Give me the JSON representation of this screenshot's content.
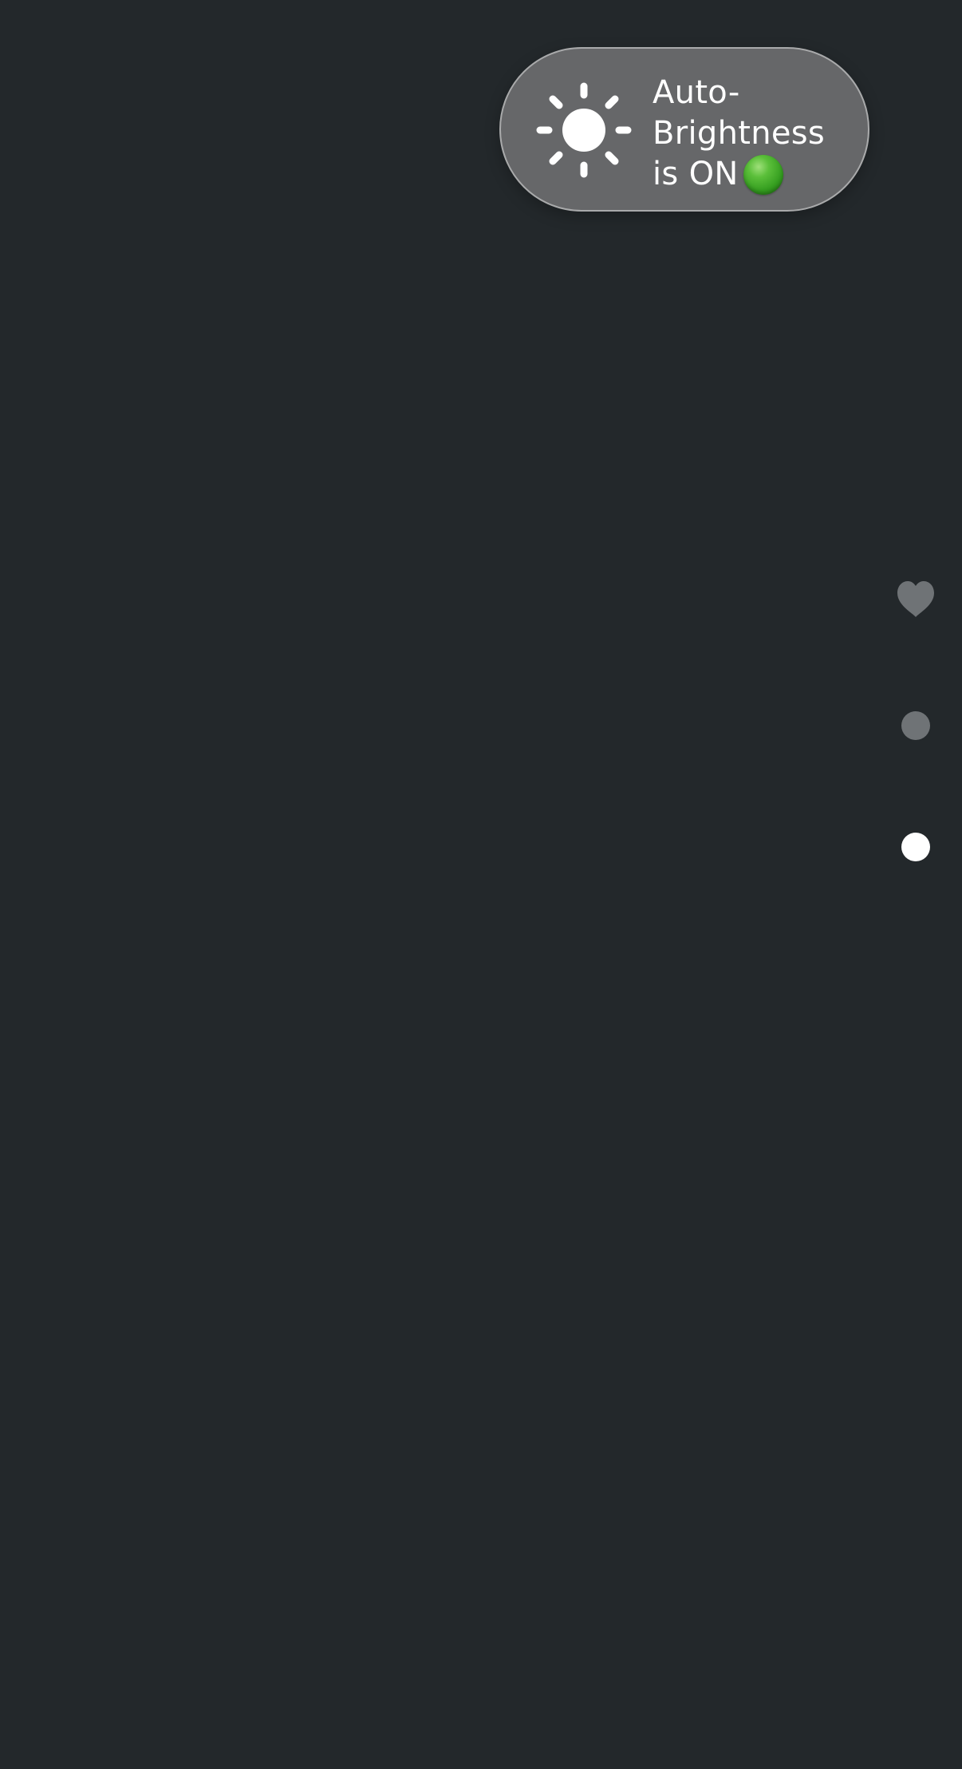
{
  "toast": {
    "icon": "sun-icon",
    "line1": "Auto-",
    "line2": "Brightness",
    "line3": "is ON",
    "status_indicator": "green-circle-icon",
    "status_color": "#3fa52a"
  },
  "page_indicators": {
    "items": [
      {
        "icon": "heart-icon",
        "state": "inactive"
      },
      {
        "icon": "dot",
        "state": "inactive"
      },
      {
        "icon": "dot",
        "state": "active"
      }
    ],
    "active_index": 2
  },
  "colors": {
    "background": "#23282b",
    "toast_background": "#666769",
    "toast_border": "#a9aaab",
    "indicator_inactive": "#6f7376",
    "indicator_active": "#ffffff",
    "text": "#ffffff"
  }
}
